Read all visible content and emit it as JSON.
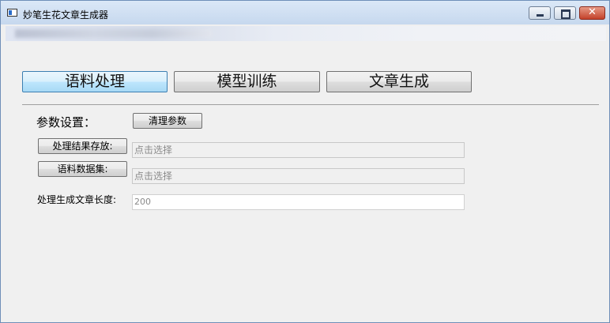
{
  "window": {
    "title": "妙笔生花文章生成器",
    "close_glyph": "✕"
  },
  "tabs": [
    {
      "label": "语料处理",
      "active": true
    },
    {
      "label": "模型训练",
      "active": false
    },
    {
      "label": "文章生成",
      "active": false
    }
  ],
  "params": {
    "section_label": "参数设置：",
    "clear_button": "清理参数",
    "save_button": "处理结果存放:",
    "save_placeholder": "点击选择",
    "corpus_button": "语料数据集:",
    "corpus_placeholder": "点击选择",
    "length_label": "处理生成文章长度:",
    "length_value": "200"
  },
  "colors": {
    "active_tab": "#bee6fd",
    "window_bg": "#f0f0f0",
    "close_button": "#c3412a"
  }
}
